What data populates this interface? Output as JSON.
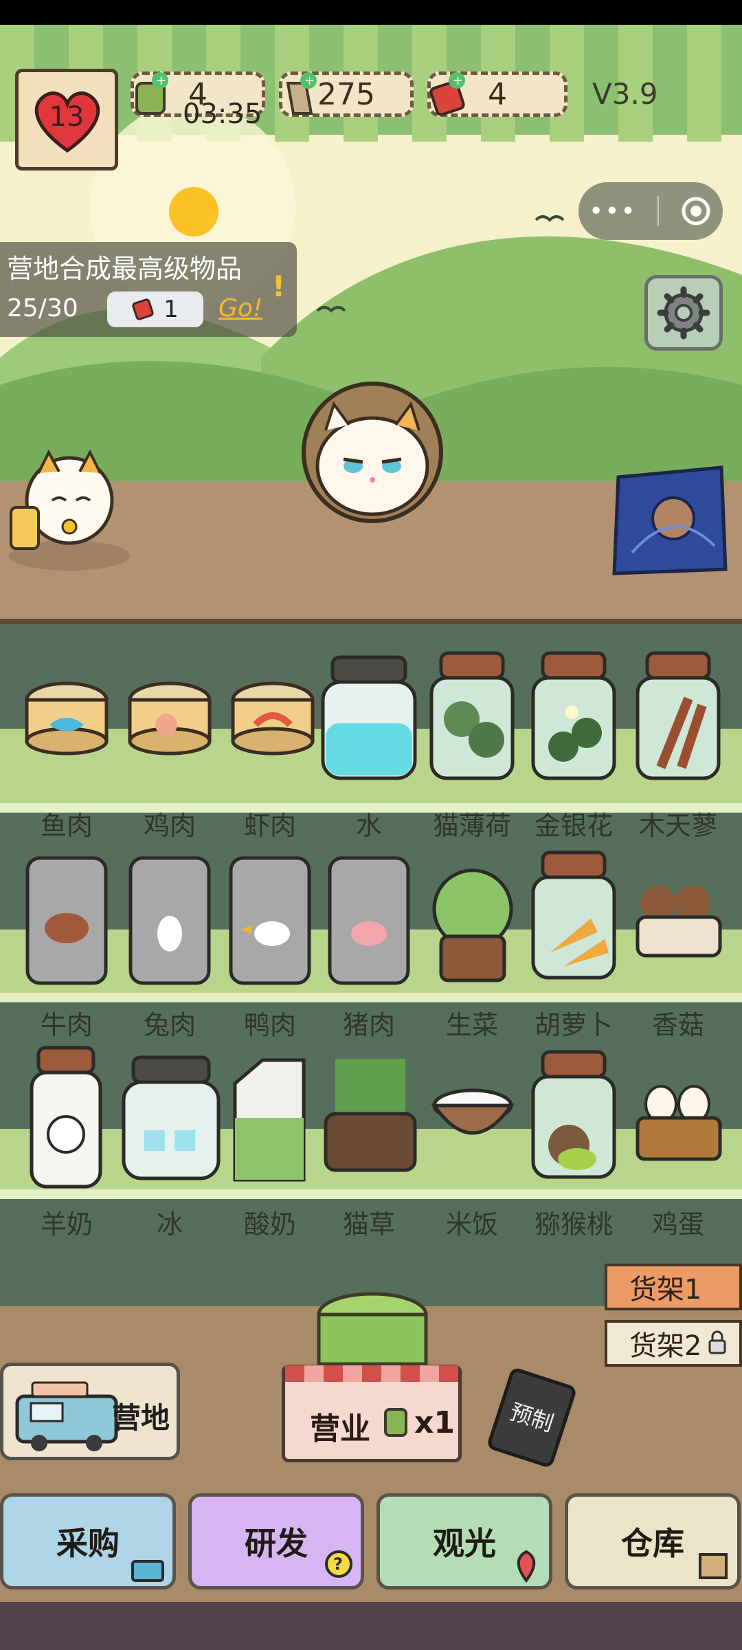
{
  "hud": {
    "level": "13",
    "fish_count": "4",
    "coin_count": "275",
    "ticket_count": "4",
    "version": "V3.9",
    "time": "03:35"
  },
  "task": {
    "title": "营地合成最高级物品",
    "progress": "25/30",
    "reward": "1",
    "go": "Go!"
  },
  "shelf": {
    "rows": [
      [
        "鱼肉",
        "鸡肉",
        "虾肉",
        "水",
        "猫薄荷",
        "金银花",
        "木天蓼"
      ],
      [
        "牛肉",
        "兔肉",
        "鸭肉",
        "猪肉",
        "生菜",
        "胡萝卜",
        "香菇"
      ],
      [
        "羊奶",
        "冰",
        "酸奶",
        "猫草",
        "米饭",
        "猕猴桃",
        "鸡蛋"
      ]
    ]
  },
  "tabs": [
    "货架1",
    "货架2"
  ],
  "camp_label": "营地",
  "business": {
    "label": "营业",
    "multiplier": "x1"
  },
  "prep_label": "预制",
  "bottom_buttons": [
    "采购",
    "研发",
    "观光",
    "仓库"
  ],
  "colors": {
    "sky": "#f4f0c8",
    "hill": "#8fc76e",
    "shelf_green": "#55735d",
    "shelf_light": "#b6d388",
    "wood": "#b89b76",
    "btn_buy": "#add4e7",
    "btn_research": "#d7b4f3",
    "btn_tour": "#b3ddb6",
    "btn_storage": "#ebe4c8"
  }
}
